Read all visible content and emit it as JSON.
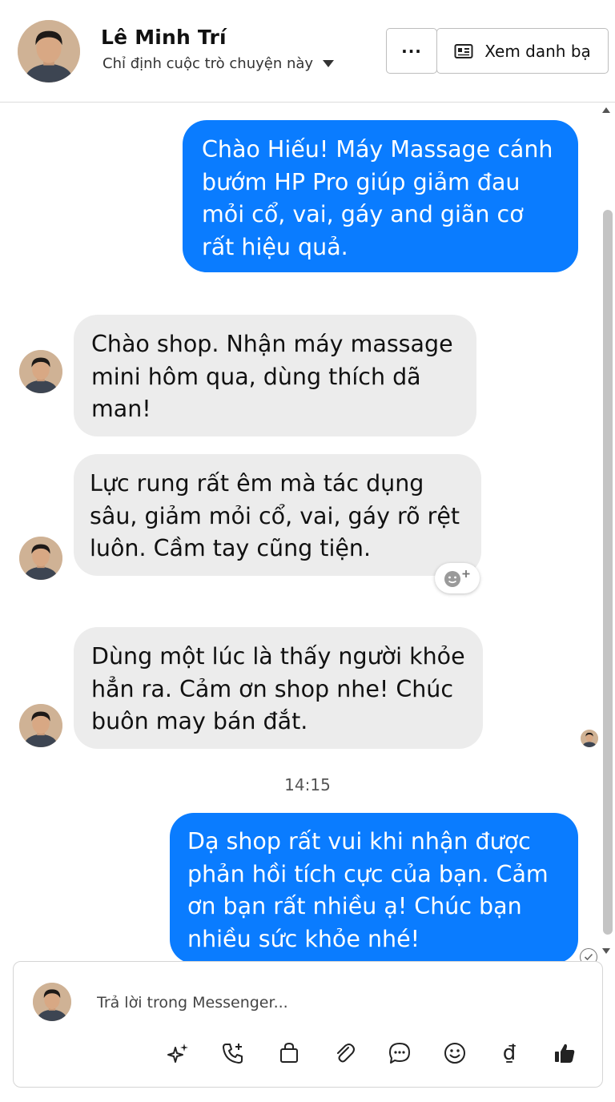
{
  "header": {
    "contact_name": "Lê Minh Trí",
    "assign_label": "Chỉ định cuộc trò chuyện này",
    "more_label": "···",
    "contacts_label": "Xem danh bạ"
  },
  "messages": [
    {
      "from": "page",
      "text": "Chào Hiếu! Máy Massage cánh bướm HP Pro giúp giảm đau mỏi cổ, vai, gáy and giãn cơ rất hiệu quả."
    },
    {
      "from": "customer",
      "text": "Chào shop. Nhận máy massage mini hôm qua, dùng thích dã man!"
    },
    {
      "from": "customer",
      "text": "Lực rung rất êm mà tác dụng sâu, giảm mỏi cổ, vai, gáy rõ rệt luôn. Cầm tay cũng tiện."
    },
    {
      "from": "customer",
      "text": "Dùng một lúc là thấy người khỏe hẳn ra. Cảm ơn shop nhe! Chúc buôn may bán đắt."
    },
    {
      "from": "page",
      "text": "Dạ shop rất vui khi nhận được phản hồi tích cực của bạn. Cảm ơn bạn rất nhiều ạ! Chúc bạn nhiều sức khỏe nhé!"
    }
  ],
  "timestamp": "14:15",
  "composer": {
    "placeholder": "Trả lời trong Messenger...",
    "icons": [
      "sparkle-icon",
      "phone-add-icon",
      "shopping-bag-icon",
      "paperclip-icon",
      "chat-bubble-icon",
      "emoji-icon",
      "currency-dong-icon",
      "thumbs-up-icon"
    ],
    "currency_symbol": "₫"
  },
  "colors": {
    "outgoing_bubble": "#0a7cff",
    "incoming_bubble": "#ececec",
    "icon_color": "#222222"
  }
}
